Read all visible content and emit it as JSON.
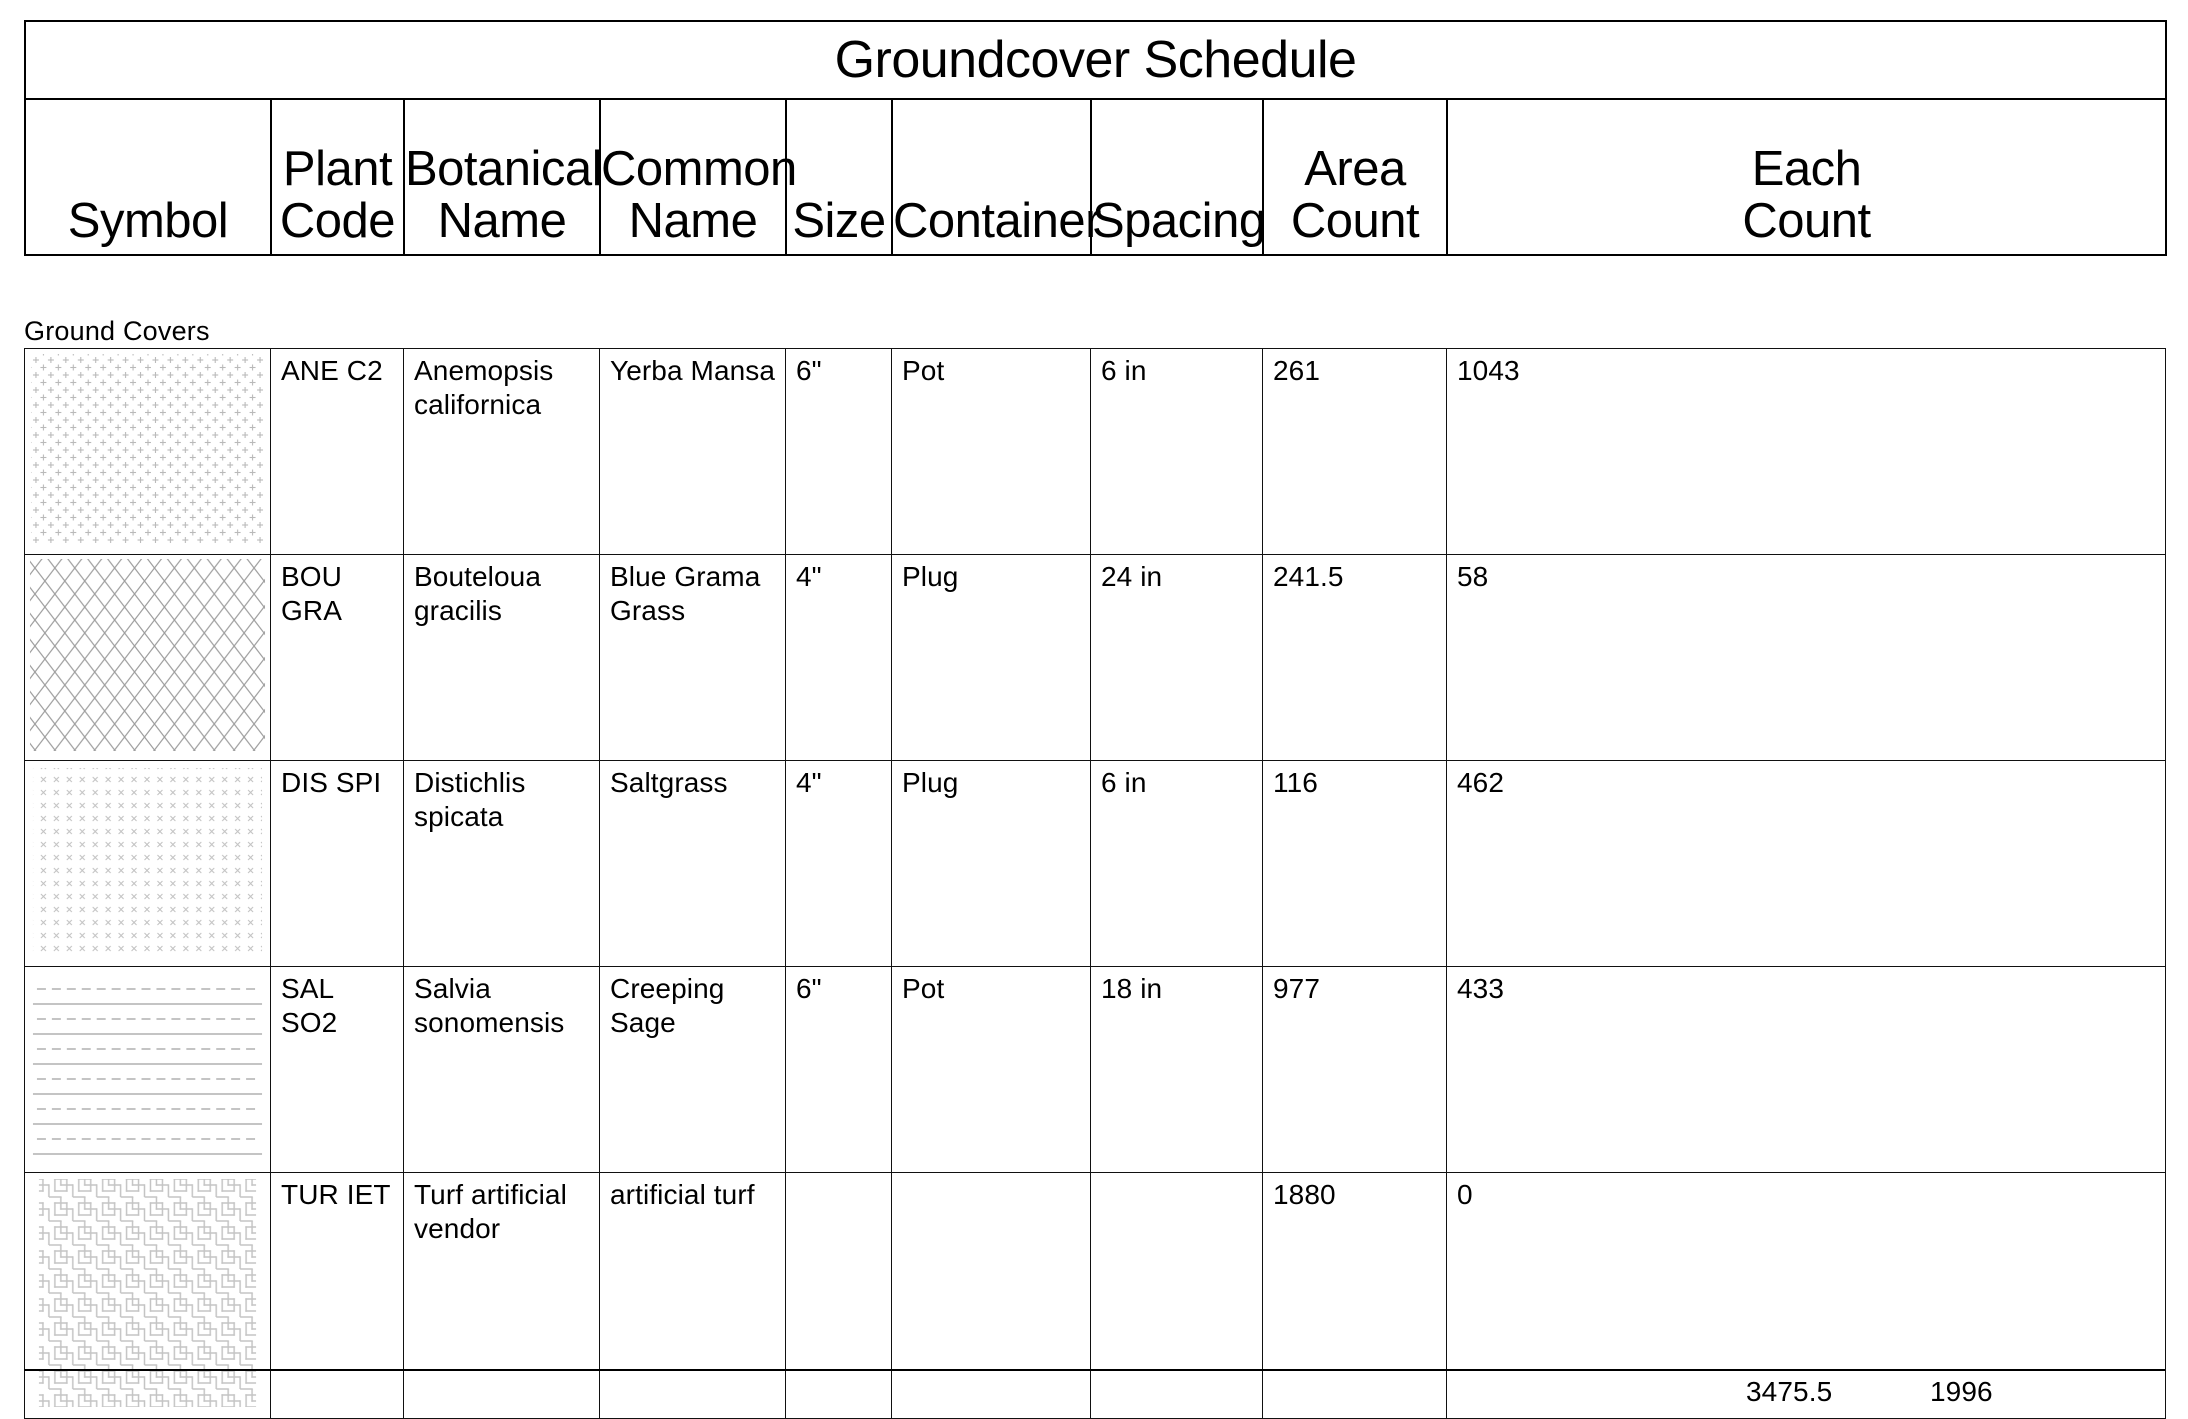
{
  "schedule": {
    "title": "Groundcover Schedule",
    "group_label": "Ground Covers",
    "columns": [
      {
        "key": "symbol",
        "label_lines": [
          "Symbol"
        ]
      },
      {
        "key": "plant_code",
        "label_lines": [
          "Plant",
          "Code"
        ]
      },
      {
        "key": "botanical",
        "label_lines": [
          "Botanical",
          "Name"
        ]
      },
      {
        "key": "common",
        "label_lines": [
          "Common",
          "Name"
        ]
      },
      {
        "key": "size",
        "label_lines": [
          "Size"
        ]
      },
      {
        "key": "container",
        "label_lines": [
          "Container"
        ]
      },
      {
        "key": "spacing",
        "label_lines": [
          "Spacing"
        ]
      },
      {
        "key": "area_count",
        "label_lines": [
          "Area",
          "Count"
        ]
      },
      {
        "key": "each_count",
        "label_lines": [
          "Each",
          "Count"
        ]
      }
    ],
    "rows": [
      {
        "symbol_pattern": "plus-dot-grid-hatch",
        "plant_code": "ANE C2",
        "botanical": "Anemopsis californica",
        "common": "Yerba Mansa",
        "size": "6\"",
        "container": "Pot",
        "spacing": "6 in",
        "area_count": "261",
        "each_count": "1043"
      },
      {
        "symbol_pattern": "diagonal-crosshatch-diamond",
        "plant_code": "BOU GRA",
        "botanical": "Bouteloua gracilis",
        "common": "Blue Grama Grass",
        "size": "4\"",
        "container": "Plug",
        "spacing": "24 in",
        "area_count": "241.5",
        "each_count": "58"
      },
      {
        "symbol_pattern": "x-mark-grid-hatch",
        "plant_code": "DIS SPI",
        "botanical": "Distichlis spicata",
        "common": "Saltgrass",
        "size": "4\"",
        "container": "Plug",
        "spacing": "6 in",
        "area_count": "116",
        "each_count": "462"
      },
      {
        "symbol_pattern": "horizontal-dashed-solid-lines",
        "plant_code": "SAL SO2",
        "botanical": "Salvia sonomensis",
        "common": "Creeping Sage",
        "size": "6\"",
        "container": "Pot",
        "spacing": "18 in",
        "area_count": "977",
        "each_count": "433"
      },
      {
        "symbol_pattern": "herringbone-basketweave",
        "plant_code": "TUR IET",
        "botanical": "Turf artificial vendor",
        "common": "artificial turf",
        "size": "",
        "container": "",
        "spacing": "",
        "area_count": "1880",
        "each_count": "0"
      }
    ],
    "totals": {
      "area_count": "3475.5",
      "each_count": "1996"
    }
  },
  "colors": {
    "rule": "#000000",
    "hatch": "#b4b4b4",
    "hatch_dark": "#8c8c8c",
    "text": "#000000",
    "background": "#ffffff"
  }
}
